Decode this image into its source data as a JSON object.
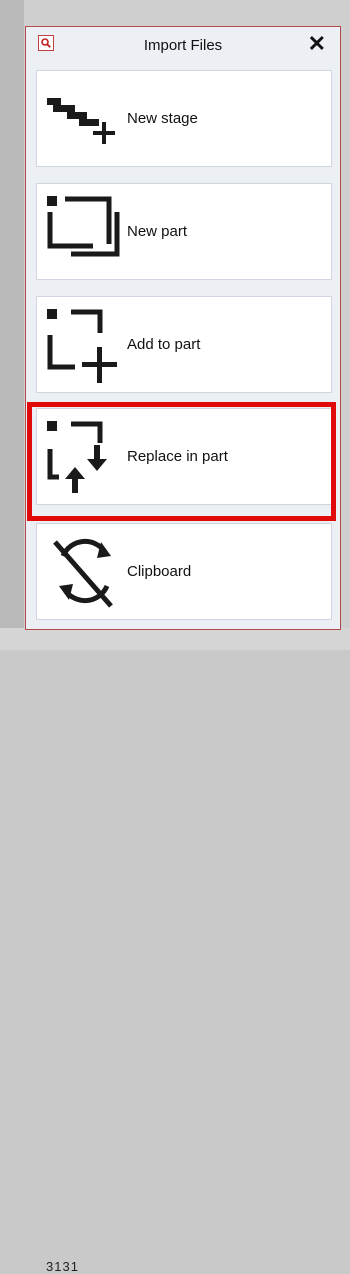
{
  "dialog": {
    "title": "Import Files",
    "search_icon": "search-icon",
    "close_label": "✕"
  },
  "options": [
    {
      "label": "New stage",
      "icon": "stairs-plus-icon"
    },
    {
      "label": "New part",
      "icon": "stacked-squares-icon"
    },
    {
      "label": "Add to part",
      "icon": "dashed-square-plus-icon"
    },
    {
      "label": "Replace in part",
      "icon": "dashed-square-swap-arrows-icon"
    },
    {
      "label": "Clipboard",
      "icon": "clipboard-off-icon"
    }
  ],
  "highlight": {
    "color": "#e10a0a",
    "target": "Replace in part"
  },
  "background": {
    "fragment_text": "3131"
  }
}
